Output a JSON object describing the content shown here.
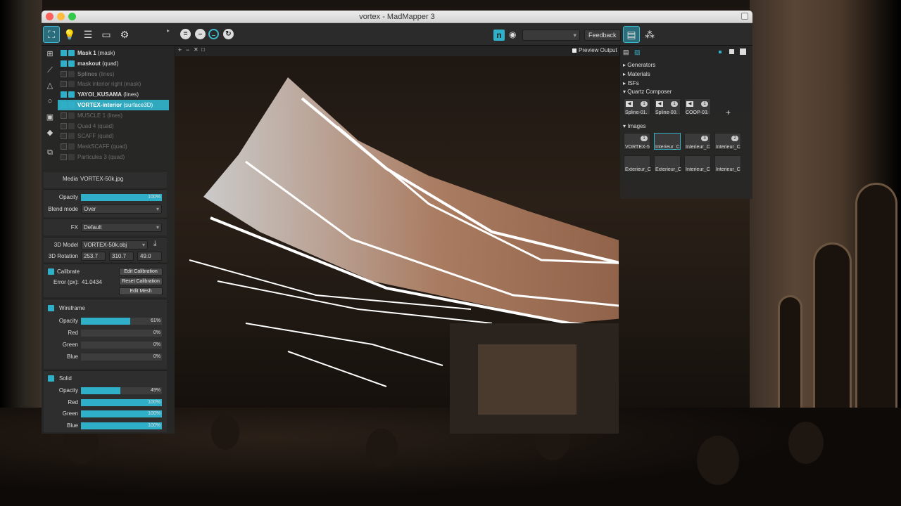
{
  "window": {
    "title": "vortex - MadMapper 3"
  },
  "toolbar": {
    "icons": [
      "mapping-mode-icon",
      "bulb-icon",
      "list-icon",
      "projector-icon",
      "gear-icon"
    ],
    "feedback_label": "Feedback",
    "preview_output_label": "Preview Output",
    "accent": "#2fb0c8"
  },
  "layers": [
    {
      "label": "Mask 1",
      "suffix": "(mask)",
      "state": "normal",
      "bold": true
    },
    {
      "label": "maskout",
      "suffix": "(quad)",
      "state": "normal",
      "bold": true
    },
    {
      "label": "Splines",
      "suffix": "(lines)",
      "state": "dim",
      "bold": true
    },
    {
      "label": "Mask interior right",
      "suffix": "(mask)",
      "state": "dim",
      "bold": false
    },
    {
      "label": "YAYOI_KUSAMA",
      "suffix": "(lines)",
      "state": "normal",
      "bold": true
    },
    {
      "label": "VORTEX-interior",
      "suffix": "(surface3D)",
      "state": "selected",
      "bold": true
    },
    {
      "label": "MUSCLE 1",
      "suffix": "(lines)",
      "state": "dim",
      "bold": false
    },
    {
      "label": "Quad 4",
      "suffix": "(quad)",
      "state": "dim",
      "bold": false
    },
    {
      "label": "SCAFF",
      "suffix": "(quad)",
      "state": "dim",
      "bold": false
    },
    {
      "label": "MaskSCAFF",
      "suffix": "(quad)",
      "state": "dim",
      "bold": false
    },
    {
      "label": "Particules 3",
      "suffix": "(quad)",
      "state": "dim",
      "bold": false
    }
  ],
  "props": {
    "media_label": "Media",
    "media_value": "VORTEX-50k.jpg",
    "opacity_label": "Opacity",
    "opacity_value": "100%",
    "opacity_fraction": 1.0,
    "blend_label": "Blend mode",
    "blend_value": "Over",
    "fx_label": "FX",
    "fx_value": "Default",
    "model_label": "3D Model",
    "model_value": "VORTEX-50k.obj",
    "rotation_label": "3D Rotation",
    "rot_x": "253.7",
    "rot_y": "310.7",
    "rot_z": "49.0",
    "calibrate_label": "Calibrate",
    "error_label": "Error (px):",
    "error_value": "41.0434",
    "edit_calibration": "Edit Calibration",
    "reset_calibration": "Reset Calibration",
    "edit_mesh": "Edit Mesh"
  },
  "wireframe": {
    "title": "Wireframe",
    "rows": [
      {
        "label": "Opacity",
        "value": "61%",
        "fraction": 0.61
      },
      {
        "label": "Red",
        "value": "0%",
        "fraction": 0.0
      },
      {
        "label": "Green",
        "value": "0%",
        "fraction": 0.0
      },
      {
        "label": "Blue",
        "value": "0%",
        "fraction": 0.0
      }
    ]
  },
  "solid": {
    "title": "Solid",
    "rows": [
      {
        "label": "Opacity",
        "value": "49%",
        "fraction": 0.49
      },
      {
        "label": "Red",
        "value": "100%",
        "fraction": 1.0
      },
      {
        "label": "Green",
        "value": "100%",
        "fraction": 1.0
      },
      {
        "label": "Blue",
        "value": "100%",
        "fraction": 1.0
      }
    ]
  },
  "library": {
    "generators": "Generators",
    "materials": "Materials",
    "isfs": "ISFs",
    "quartz": "Quartz Composer",
    "images": "Images",
    "quartz_items": [
      {
        "caption": "Spline-01.",
        "badge": "1"
      },
      {
        "caption": "Spline-00.",
        "badge": "1"
      },
      {
        "caption": "COOP-03.",
        "badge": "1"
      }
    ],
    "image_items": [
      {
        "caption": "VORTEX-5",
        "badge": "1"
      },
      {
        "caption": "Interieur_C",
        "badge": ""
      },
      {
        "caption": "Interieur_C",
        "badge": "3"
      },
      {
        "caption": "Interieur_C",
        "badge": "2"
      },
      {
        "caption": "Exterieur_C",
        "badge": ""
      },
      {
        "caption": "Exterieur_C",
        "badge": ""
      },
      {
        "caption": "Interieur_C",
        "badge": ""
      },
      {
        "caption": "Interieur_C",
        "badge": ""
      }
    ]
  }
}
